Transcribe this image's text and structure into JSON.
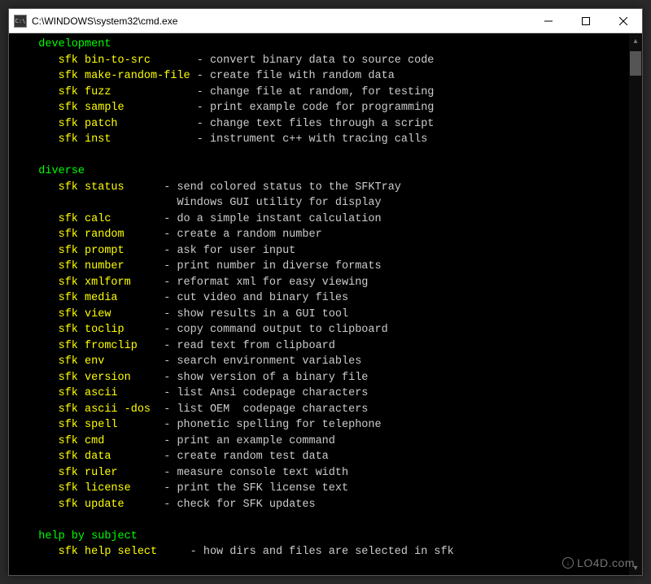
{
  "window": {
    "icon_text": "C:\\",
    "title": "C:\\WINDOWS\\system32\\cmd.exe"
  },
  "content": {
    "sections": [
      {
        "header": "   development",
        "items": [
          {
            "cmd": "      sfk bin-to-src      ",
            "sep": " - ",
            "desc": "convert binary data to source code"
          },
          {
            "cmd": "      sfk make-random-file",
            "sep": " - ",
            "desc": "create file with random data"
          },
          {
            "cmd": "      sfk fuzz            ",
            "sep": " - ",
            "desc": "change file at random, for testing"
          },
          {
            "cmd": "      sfk sample          ",
            "sep": " - ",
            "desc": "print example code for programming"
          },
          {
            "cmd": "      sfk patch           ",
            "sep": " - ",
            "desc": "change text files through a script"
          },
          {
            "cmd": "      sfk inst            ",
            "sep": " - ",
            "desc": "instrument c++ with tracing calls"
          }
        ]
      },
      {
        "header": "   diverse",
        "items": [
          {
            "cmd": "      sfk status     ",
            "sep": " - ",
            "desc": "send colored status to the SFKTray"
          },
          {
            "cmd": "                     ",
            "sep": "   ",
            "desc": "Windows GUI utility for display"
          },
          {
            "cmd": "      sfk calc       ",
            "sep": " - ",
            "desc": "do a simple instant calculation"
          },
          {
            "cmd": "      sfk random     ",
            "sep": " - ",
            "desc": "create a random number"
          },
          {
            "cmd": "      sfk prompt     ",
            "sep": " - ",
            "desc": "ask for user input"
          },
          {
            "cmd": "      sfk number     ",
            "sep": " - ",
            "desc": "print number in diverse formats"
          },
          {
            "cmd": "      sfk xmlform    ",
            "sep": " - ",
            "desc": "reformat xml for easy viewing"
          },
          {
            "cmd": "      sfk media      ",
            "sep": " - ",
            "desc": "cut video and binary files"
          },
          {
            "cmd": "      sfk view       ",
            "sep": " - ",
            "desc": "show results in a GUI tool"
          },
          {
            "cmd": "      sfk toclip     ",
            "sep": " - ",
            "desc": "copy command output to clipboard"
          },
          {
            "cmd": "      sfk fromclip   ",
            "sep": " - ",
            "desc": "read text from clipboard"
          },
          {
            "cmd": "      sfk env        ",
            "sep": " - ",
            "desc": "search environment variables"
          },
          {
            "cmd": "      sfk version    ",
            "sep": " - ",
            "desc": "show version of a binary file"
          },
          {
            "cmd": "      sfk ascii      ",
            "sep": " - ",
            "desc": "list Ansi codepage characters"
          },
          {
            "cmd": "      sfk ascii -dos ",
            "sep": " - ",
            "desc": "list OEM  codepage characters"
          },
          {
            "cmd": "      sfk spell      ",
            "sep": " - ",
            "desc": "phonetic spelling for telephone"
          },
          {
            "cmd": "      sfk cmd        ",
            "sep": " - ",
            "desc": "print an example command"
          },
          {
            "cmd": "      sfk data       ",
            "sep": " - ",
            "desc": "create random test data"
          },
          {
            "cmd": "      sfk ruler      ",
            "sep": " - ",
            "desc": "measure console text width"
          },
          {
            "cmd": "      sfk license    ",
            "sep": " - ",
            "desc": "print the SFK license text"
          },
          {
            "cmd": "      sfk update     ",
            "sep": " - ",
            "desc": "check for SFK updates"
          }
        ]
      },
      {
        "header": "   help by subject",
        "items": [
          {
            "cmd": "      sfk help select    ",
            "sep": " - ",
            "desc": "how dirs and files are selected in sfk"
          }
        ]
      }
    ]
  },
  "watermark": {
    "text": "LO4D.com"
  }
}
